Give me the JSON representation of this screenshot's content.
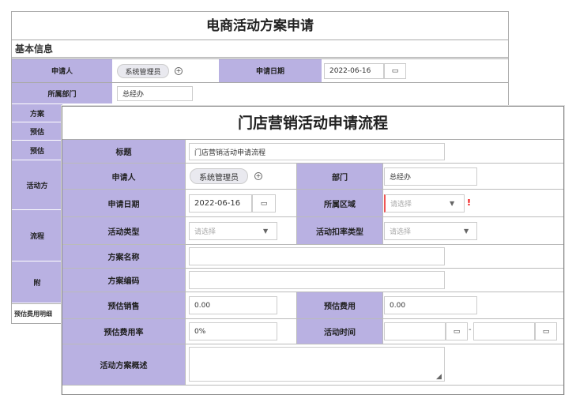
{
  "back_form": {
    "title": "电商活动方案申请",
    "section": "基本信息",
    "applicant_label": "申请人",
    "applicant_value": "系统管理员",
    "date_label": "申请日期",
    "date_value": "2022-06-16",
    "dept_label": "所属部门",
    "dept_value": "总经办",
    "partial_labels": [
      "方案",
      "预估",
      "预估",
      "活动方",
      "流程",
      "附"
    ],
    "footer_label": "预估费用明细"
  },
  "front_form": {
    "title": "门店营销活动申请流程",
    "title_label": "标题",
    "title_value": "门店营销活动申请流程",
    "applicant_label": "申请人",
    "applicant_value": "系统管理员",
    "dept_label": "部门",
    "dept_value": "总经办",
    "date_label": "申请日期",
    "date_value": "2022-06-16",
    "region_label": "所属区域",
    "region_placeholder": "请选择",
    "activity_type_label": "活动类型",
    "activity_type_placeholder": "请选择",
    "discount_type_label": "活动扣率类型",
    "discount_type_placeholder": "请选择",
    "plan_name_label": "方案名称",
    "plan_code_label": "方案编码",
    "est_sales_label": "预估销售",
    "est_sales_value": "0.00",
    "est_cost_label": "预估费用",
    "est_cost_value": "0.00",
    "est_cost_rate_label": "预估费用率",
    "est_cost_rate_value": "0%",
    "activity_time_label": "活动时间",
    "activity_time_sep": "-",
    "overview_label": "活动方案概述",
    "required_mark": "!"
  },
  "icons": {
    "calendar": "calendar-icon",
    "add": "add-circle-icon",
    "dropdown": "chevron-down-icon",
    "resize": "resize-handle-icon"
  },
  "colors": {
    "label_bg": "#b9b1e2",
    "border": "#aaaaaa",
    "required": "#ee0000"
  }
}
